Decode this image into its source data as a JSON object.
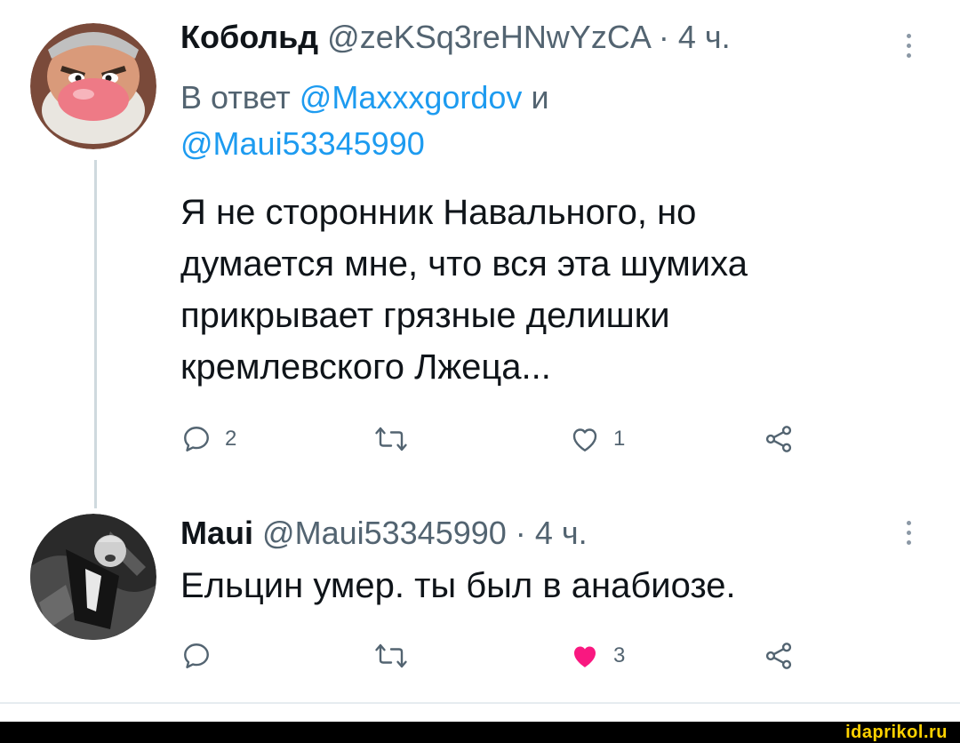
{
  "tweet1": {
    "name": "Кобольд",
    "handle": "@zeKSq3reHNwYzCA",
    "separator": "·",
    "time": "4 ч.",
    "reply_prefix": "В ответ",
    "mention1": "@Maxxxgordov",
    "conjunction": "и",
    "mention2": "@Maui53345990",
    "text_lines": [
      "Я не сторонник Навального, но",
      "думается мне, что вся эта шумиха",
      "прикрывает грязные делишки",
      "кремлевского Лжеца..."
    ],
    "actions": {
      "reply_count": "2",
      "like_count": "1"
    }
  },
  "tweet2": {
    "name": "Maui",
    "handle": "@Maui53345990",
    "separator": "·",
    "time": "4 ч.",
    "text": "Ельцин умер. ты был в анабиозе.",
    "actions": {
      "like_count": "3"
    },
    "like_color": "#f91880"
  },
  "icons": {
    "reply": "reply-icon",
    "retweet": "retweet-icon",
    "like": "heart-icon",
    "share": "share-icon",
    "more": "more-vertical-icon"
  },
  "watermark": "idaprikol.ru"
}
